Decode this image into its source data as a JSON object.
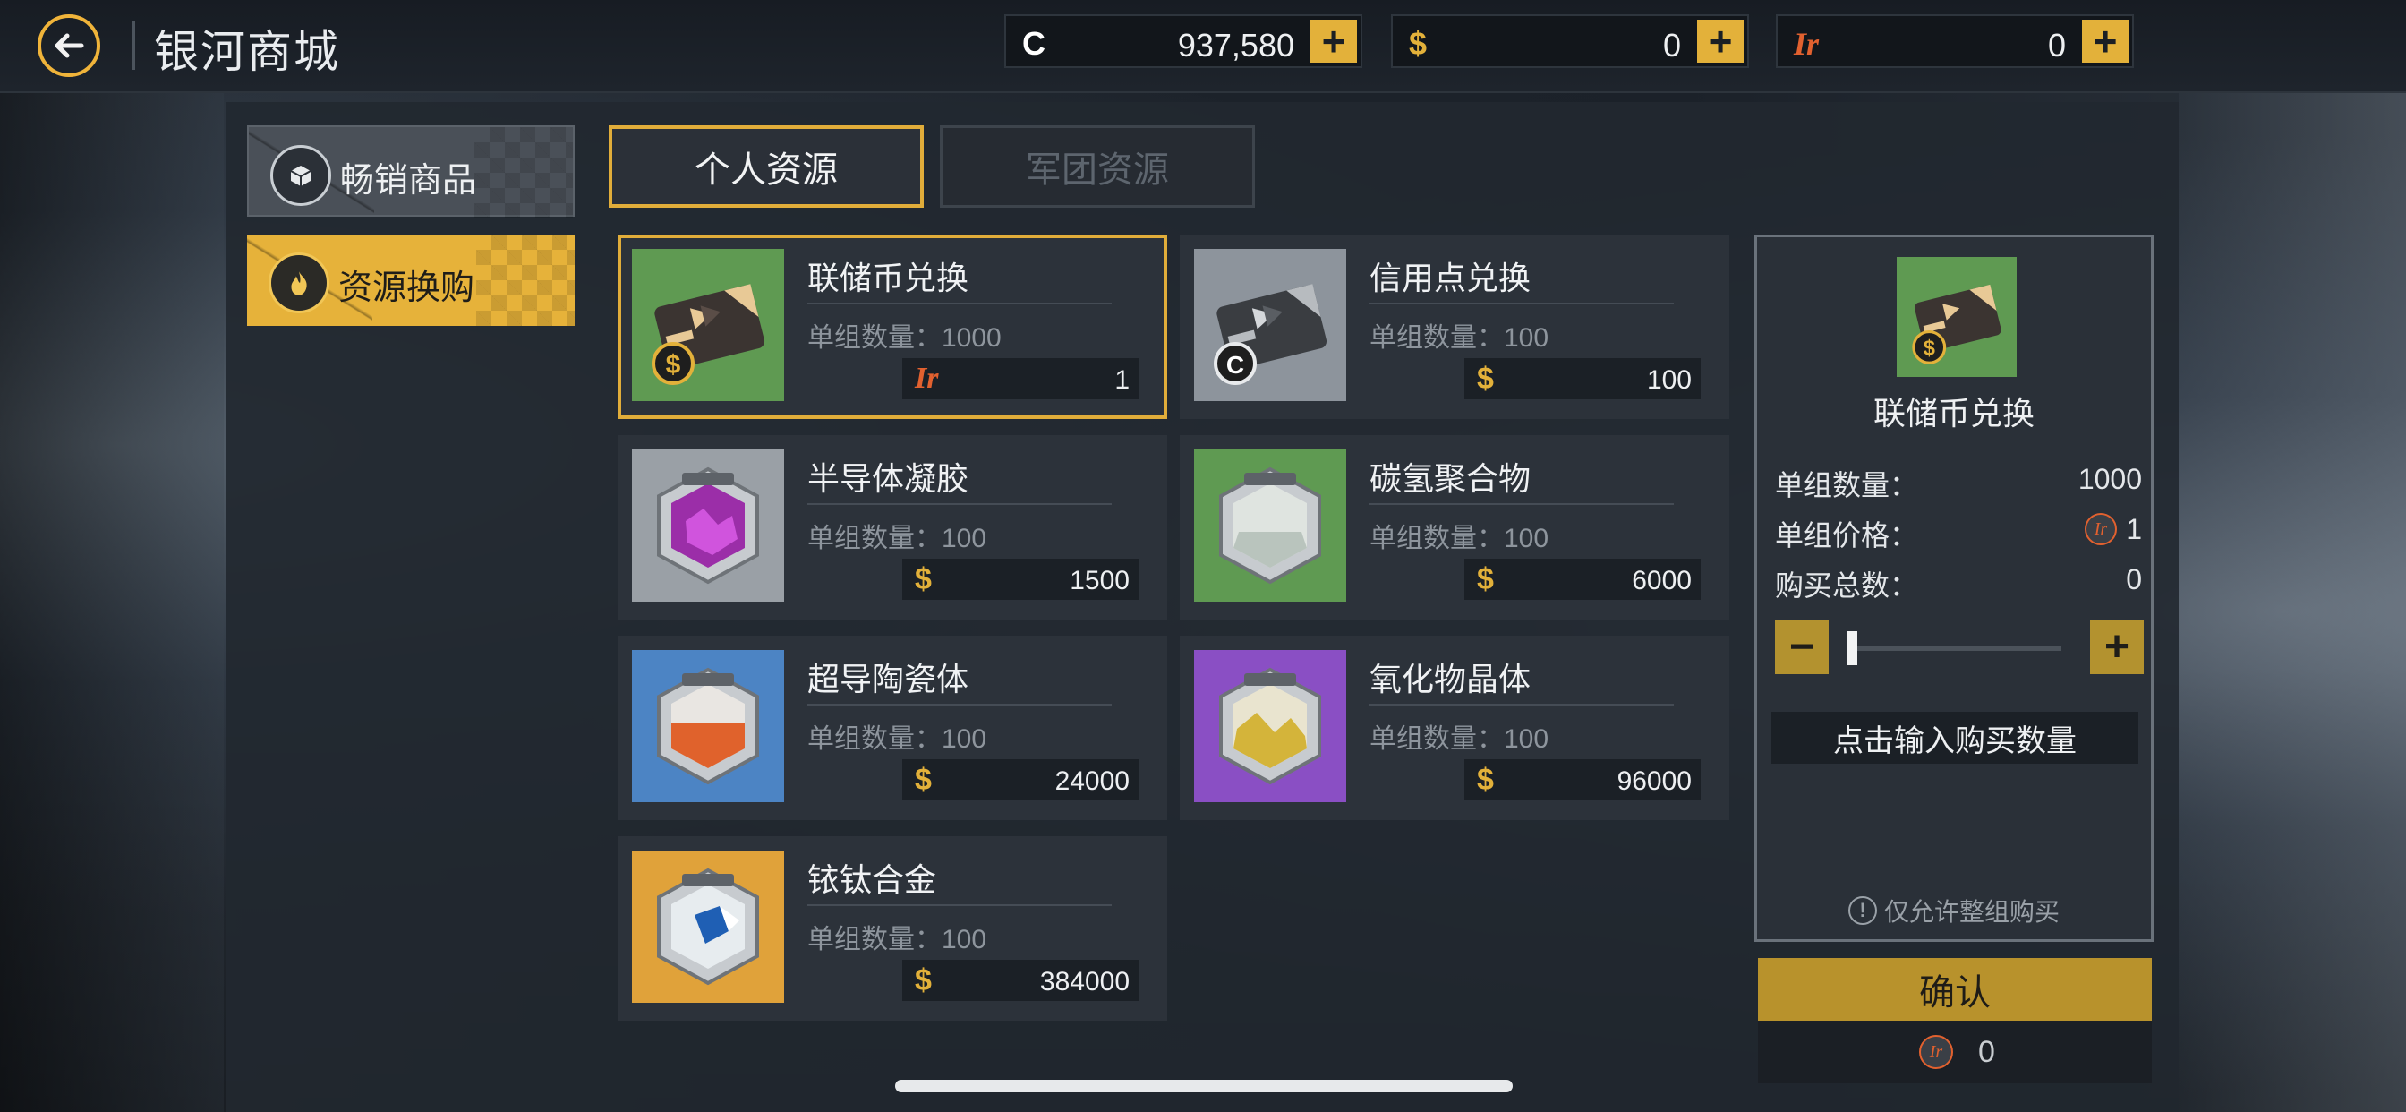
{
  "header": {
    "title": "银河商城",
    "currencies": [
      {
        "symbol": "C",
        "amount": "937,580",
        "color": "#ffffff"
      },
      {
        "symbol": "$",
        "amount": "0",
        "color": "#e3b13a"
      },
      {
        "symbol": "Ir",
        "amount": "0",
        "color": "#e2612f"
      }
    ],
    "plus_label": "+"
  },
  "sidebar": {
    "items": [
      {
        "label": "畅销商品",
        "icon": "cube-icon",
        "active": false
      },
      {
        "label": "资源换购",
        "icon": "flame-icon",
        "active": true
      }
    ]
  },
  "tabs": [
    {
      "label": "个人资源",
      "active": true
    },
    {
      "label": "军团资源",
      "active": false
    }
  ],
  "items": [
    {
      "name": "联储币兑换",
      "qty": "单组数量：1000",
      "currency": "Ir",
      "price": "1",
      "selected": true,
      "bg": "#5f9a52",
      "kind": "card-dollar"
    },
    {
      "name": "信用点兑换",
      "qty": "单组数量：100",
      "currency": "$",
      "price": "100",
      "selected": false,
      "bg": "#8d949c",
      "kind": "card-credit"
    },
    {
      "name": "半导体凝胶",
      "qty": "单组数量：100",
      "currency": "$",
      "price": "1500",
      "selected": false,
      "bg": "#9aa0a6",
      "kind": "hex-purple"
    },
    {
      "name": "碳氢聚合物",
      "qty": "单组数量：100",
      "currency": "$",
      "price": "6000",
      "selected": false,
      "bg": "#5f9a52",
      "kind": "hex-white"
    },
    {
      "name": "超导陶瓷体",
      "qty": "单组数量：100",
      "currency": "$",
      "price": "24000",
      "selected": false,
      "bg": "#4c84c4",
      "kind": "hex-orange"
    },
    {
      "name": "氧化物晶体",
      "qty": "单组数量：100",
      "currency": "$",
      "price": "96000",
      "selected": false,
      "bg": "#8a4fc4",
      "kind": "hex-gold"
    },
    {
      "name": "铱钛合金",
      "qty": "单组数量：100",
      "currency": "$",
      "price": "384000",
      "selected": false,
      "bg": "#e0a23a",
      "kind": "hex-blue"
    }
  ],
  "detail": {
    "name": "联储币兑换",
    "rows": [
      {
        "label": "单组数量：",
        "value": "1000"
      },
      {
        "label": "单组价格：",
        "value": "1"
      },
      {
        "label": "购买总数：",
        "value": "0"
      }
    ],
    "minus": "−",
    "plus": "+",
    "input_label": "点击输入购买数量",
    "note": "仅允许整组购买",
    "slider_fraction": 0
  },
  "confirm": {
    "label": "确认",
    "cost": "0"
  },
  "colors": {
    "accent": "#e1ad3a",
    "dollar": "#e3b13a",
    "iridium": "#e2612f"
  }
}
